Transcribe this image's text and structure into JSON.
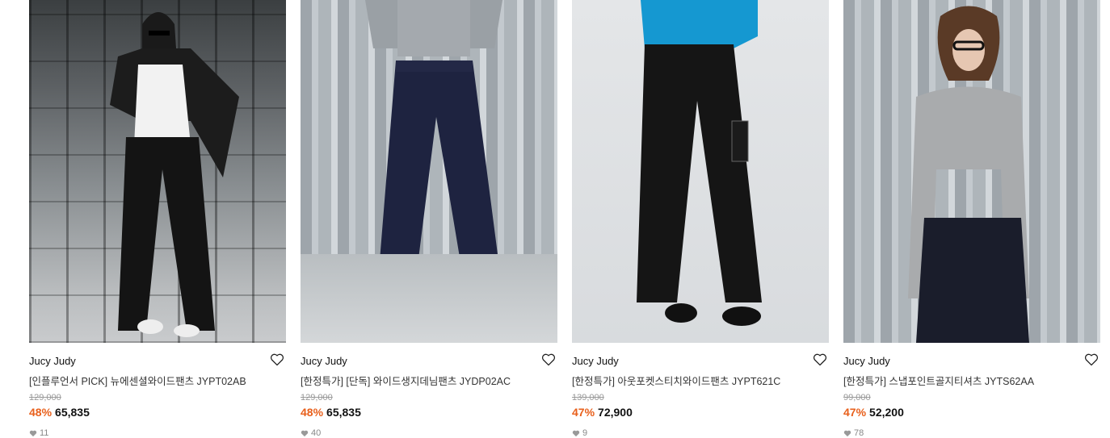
{
  "colors": {
    "discount": "#e8601c",
    "text": "#111111",
    "muted": "#999999"
  },
  "products": [
    {
      "brand": "Jucy Judy",
      "title": "[인플루언서 PICK] 뉴에센셜와이드팬츠 JYPT02AB",
      "original_price": "129,000",
      "discount": "48%",
      "price": "65,835",
      "likes": "11"
    },
    {
      "brand": "Jucy Judy",
      "title": "[한정특가] [단독] 와이드생지데님팬츠 JYDP02AC",
      "original_price": "129,000",
      "discount": "48%",
      "price": "65,835",
      "likes": "40"
    },
    {
      "brand": "Jucy Judy",
      "title": "[한정특가] 아웃포켓스티치와이드팬츠 JYPT621C",
      "original_price": "139,000",
      "discount": "47%",
      "price": "72,900",
      "likes": "9"
    },
    {
      "brand": "Jucy Judy",
      "title": "[한정특가] 스냅포인트골지티셔츠 JYTS62AA",
      "original_price": "99,000",
      "discount": "47%",
      "price": "52,200",
      "likes": "78"
    }
  ]
}
